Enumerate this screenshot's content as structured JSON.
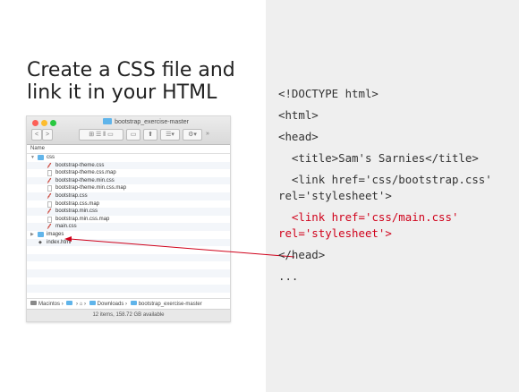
{
  "slide": {
    "title": "Create a CSS file and link it in your HTML"
  },
  "finder": {
    "window_title": "bootstrap_exercise-master",
    "column_header": "Name",
    "toolbar_more": "»",
    "items": [
      {
        "name": "css",
        "kind": "folder",
        "expanded": true
      },
      {
        "name": "bootstrap-theme.css",
        "kind": "css"
      },
      {
        "name": "bootstrap-theme.css.map",
        "kind": "file"
      },
      {
        "name": "bootstrap-theme.min.css",
        "kind": "css"
      },
      {
        "name": "bootstrap-theme.min.css.map",
        "kind": "file"
      },
      {
        "name": "bootstrap.css",
        "kind": "css"
      },
      {
        "name": "bootstrap.css.map",
        "kind": "file"
      },
      {
        "name": "bootstrap.min.css",
        "kind": "css"
      },
      {
        "name": "bootstrap.min.css.map",
        "kind": "file"
      },
      {
        "name": "main.css",
        "kind": "css"
      },
      {
        "name": "images",
        "kind": "folder",
        "expanded": false
      },
      {
        "name": "index.html",
        "kind": "html"
      }
    ],
    "path_bar": {
      "drive": "Macintos",
      "downloads": "Downloads",
      "folder": "bootstrap_exercise-master"
    },
    "status": "12 items, 158.72 GB available"
  },
  "code": {
    "lines": [
      "<!DOCTYPE html>",
      "<html>",
      "<head>",
      "  <title>Sam's Sarnies</title>",
      "  <link href='css/bootstrap.css' rel='stylesheet'>",
      "  <link href='css/main.css' rel='stylesheet'>",
      "</head>",
      "..."
    ]
  },
  "colors": {
    "highlight": "#d0021b",
    "panel": "#efefef"
  }
}
